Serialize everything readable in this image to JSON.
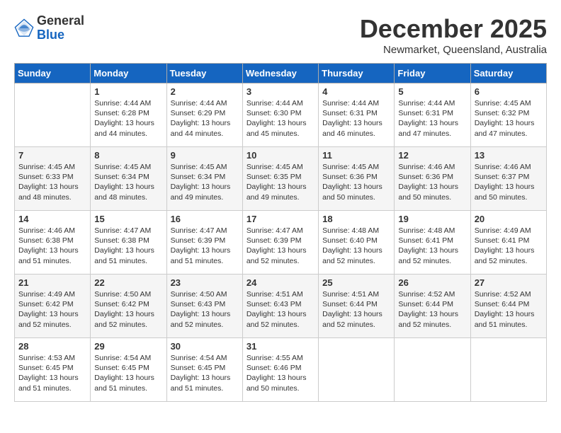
{
  "header": {
    "logo_line1": "General",
    "logo_line2": "Blue",
    "month": "December 2025",
    "location": "Newmarket, Queensland, Australia"
  },
  "days_of_week": [
    "Sunday",
    "Monday",
    "Tuesday",
    "Wednesday",
    "Thursday",
    "Friday",
    "Saturday"
  ],
  "weeks": [
    [
      {
        "day": "",
        "info": ""
      },
      {
        "day": "1",
        "info": "Sunrise: 4:44 AM\nSunset: 6:28 PM\nDaylight: 13 hours\nand 44 minutes."
      },
      {
        "day": "2",
        "info": "Sunrise: 4:44 AM\nSunset: 6:29 PM\nDaylight: 13 hours\nand 44 minutes."
      },
      {
        "day": "3",
        "info": "Sunrise: 4:44 AM\nSunset: 6:30 PM\nDaylight: 13 hours\nand 45 minutes."
      },
      {
        "day": "4",
        "info": "Sunrise: 4:44 AM\nSunset: 6:31 PM\nDaylight: 13 hours\nand 46 minutes."
      },
      {
        "day": "5",
        "info": "Sunrise: 4:44 AM\nSunset: 6:31 PM\nDaylight: 13 hours\nand 47 minutes."
      },
      {
        "day": "6",
        "info": "Sunrise: 4:45 AM\nSunset: 6:32 PM\nDaylight: 13 hours\nand 47 minutes."
      }
    ],
    [
      {
        "day": "7",
        "info": "Sunrise: 4:45 AM\nSunset: 6:33 PM\nDaylight: 13 hours\nand 48 minutes."
      },
      {
        "day": "8",
        "info": "Sunrise: 4:45 AM\nSunset: 6:34 PM\nDaylight: 13 hours\nand 48 minutes."
      },
      {
        "day": "9",
        "info": "Sunrise: 4:45 AM\nSunset: 6:34 PM\nDaylight: 13 hours\nand 49 minutes."
      },
      {
        "day": "10",
        "info": "Sunrise: 4:45 AM\nSunset: 6:35 PM\nDaylight: 13 hours\nand 49 minutes."
      },
      {
        "day": "11",
        "info": "Sunrise: 4:45 AM\nSunset: 6:36 PM\nDaylight: 13 hours\nand 50 minutes."
      },
      {
        "day": "12",
        "info": "Sunrise: 4:46 AM\nSunset: 6:36 PM\nDaylight: 13 hours\nand 50 minutes."
      },
      {
        "day": "13",
        "info": "Sunrise: 4:46 AM\nSunset: 6:37 PM\nDaylight: 13 hours\nand 50 minutes."
      }
    ],
    [
      {
        "day": "14",
        "info": "Sunrise: 4:46 AM\nSunset: 6:38 PM\nDaylight: 13 hours\nand 51 minutes."
      },
      {
        "day": "15",
        "info": "Sunrise: 4:47 AM\nSunset: 6:38 PM\nDaylight: 13 hours\nand 51 minutes."
      },
      {
        "day": "16",
        "info": "Sunrise: 4:47 AM\nSunset: 6:39 PM\nDaylight: 13 hours\nand 51 minutes."
      },
      {
        "day": "17",
        "info": "Sunrise: 4:47 AM\nSunset: 6:39 PM\nDaylight: 13 hours\nand 52 minutes."
      },
      {
        "day": "18",
        "info": "Sunrise: 4:48 AM\nSunset: 6:40 PM\nDaylight: 13 hours\nand 52 minutes."
      },
      {
        "day": "19",
        "info": "Sunrise: 4:48 AM\nSunset: 6:41 PM\nDaylight: 13 hours\nand 52 minutes."
      },
      {
        "day": "20",
        "info": "Sunrise: 4:49 AM\nSunset: 6:41 PM\nDaylight: 13 hours\nand 52 minutes."
      }
    ],
    [
      {
        "day": "21",
        "info": "Sunrise: 4:49 AM\nSunset: 6:42 PM\nDaylight: 13 hours\nand 52 minutes."
      },
      {
        "day": "22",
        "info": "Sunrise: 4:50 AM\nSunset: 6:42 PM\nDaylight: 13 hours\nand 52 minutes."
      },
      {
        "day": "23",
        "info": "Sunrise: 4:50 AM\nSunset: 6:43 PM\nDaylight: 13 hours\nand 52 minutes."
      },
      {
        "day": "24",
        "info": "Sunrise: 4:51 AM\nSunset: 6:43 PM\nDaylight: 13 hours\nand 52 minutes."
      },
      {
        "day": "25",
        "info": "Sunrise: 4:51 AM\nSunset: 6:44 PM\nDaylight: 13 hours\nand 52 minutes."
      },
      {
        "day": "26",
        "info": "Sunrise: 4:52 AM\nSunset: 6:44 PM\nDaylight: 13 hours\nand 52 minutes."
      },
      {
        "day": "27",
        "info": "Sunrise: 4:52 AM\nSunset: 6:44 PM\nDaylight: 13 hours\nand 51 minutes."
      }
    ],
    [
      {
        "day": "28",
        "info": "Sunrise: 4:53 AM\nSunset: 6:45 PM\nDaylight: 13 hours\nand 51 minutes."
      },
      {
        "day": "29",
        "info": "Sunrise: 4:54 AM\nSunset: 6:45 PM\nDaylight: 13 hours\nand 51 minutes."
      },
      {
        "day": "30",
        "info": "Sunrise: 4:54 AM\nSunset: 6:45 PM\nDaylight: 13 hours\nand 51 minutes."
      },
      {
        "day": "31",
        "info": "Sunrise: 4:55 AM\nSunset: 6:46 PM\nDaylight: 13 hours\nand 50 minutes."
      },
      {
        "day": "",
        "info": ""
      },
      {
        "day": "",
        "info": ""
      },
      {
        "day": "",
        "info": ""
      }
    ]
  ]
}
